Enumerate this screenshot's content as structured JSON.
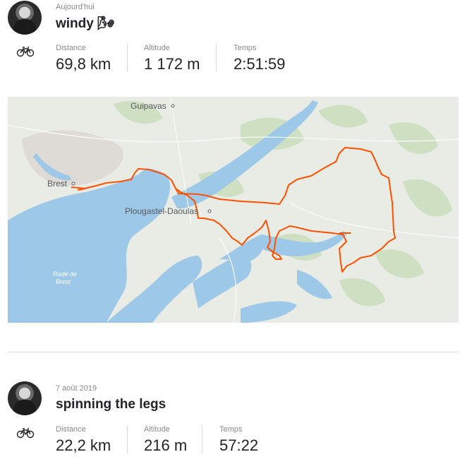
{
  "activities": [
    {
      "date": "Aujourd'hui",
      "title": "windy 🌬",
      "stats": [
        {
          "label": "Distance",
          "value": "69,8 km"
        },
        {
          "label": "Altitude",
          "value": "1 172 m"
        },
        {
          "label": "Temps",
          "value": "2:51:59"
        }
      ],
      "map": {
        "labels": {
          "guipavas": "Guipavas",
          "brest": "Brest",
          "plougastel": "Plougastel-Daoulas",
          "rade_line1": "Rade de",
          "rade_line2": "Brest"
        }
      }
    },
    {
      "date": "7 août 2019",
      "title": "spinning the legs",
      "stats": [
        {
          "label": "Distance",
          "value": "22,2 km"
        },
        {
          "label": "Altitude",
          "value": "216 m"
        },
        {
          "label": "Temps",
          "value": "57:22"
        }
      ]
    }
  ],
  "colors": {
    "route": "#fc5200",
    "water": "#9dc8e8",
    "land": "#e9ebe5",
    "park": "#cfe0c2"
  },
  "icons": {
    "activity_type": "bike-icon"
  }
}
